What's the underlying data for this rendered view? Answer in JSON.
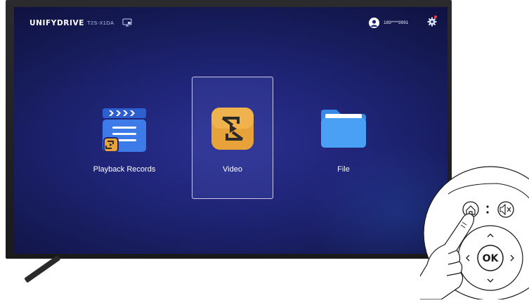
{
  "app": {
    "brand": "UNIFYDRIVE",
    "device_model": "T2S-X1DA",
    "account": "189****9991"
  },
  "tiles": [
    {
      "label": "Playback Records",
      "icon": "playback-records-icon",
      "selected": false
    },
    {
      "label": "Video",
      "icon": "video-icon",
      "selected": true
    },
    {
      "label": "File",
      "icon": "folder-icon",
      "selected": false
    }
  ],
  "remote": {
    "ok_label": "OK",
    "buttons": [
      "home-icon",
      "mute-icon",
      "chevron-up-icon",
      "chevron-left-icon",
      "chevron-right-icon",
      "chevron-down-icon"
    ]
  },
  "colors": {
    "screen_bg": "#1f2476",
    "video_tile": "#e8a23a",
    "playback_tile": "#3d7be8",
    "file_tile": "#4aa0f5",
    "notification": "#ff3b3b"
  }
}
